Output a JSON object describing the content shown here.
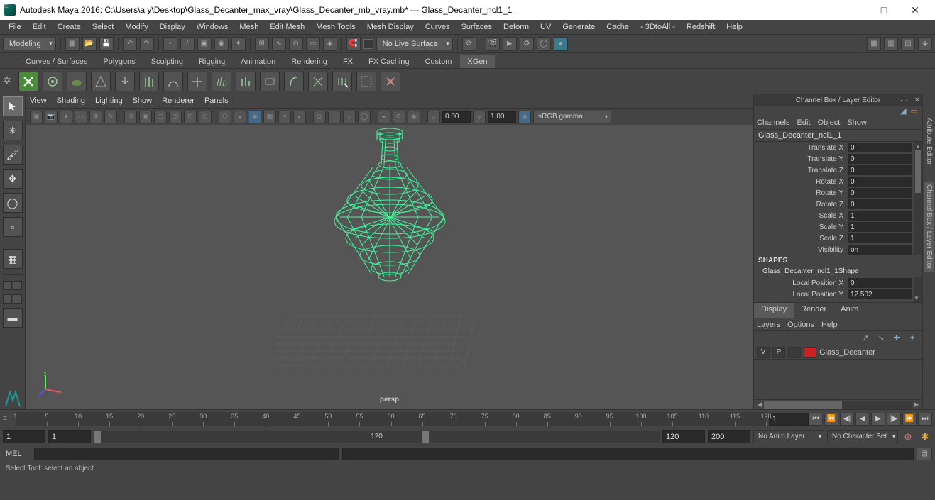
{
  "titlebar": {
    "text": "Autodesk Maya 2016: C:\\Users\\a y\\Desktop\\Glass_Decanter_max_vray\\Glass_Decanter_mb_vray.mb*   ---   Glass_Decanter_ncl1_1"
  },
  "menus": [
    "File",
    "Edit",
    "Create",
    "Select",
    "Modify",
    "Display",
    "Windows",
    "Mesh",
    "Edit Mesh",
    "Mesh Tools",
    "Mesh Display",
    "Curves",
    "Surfaces",
    "Deform",
    "UV",
    "Generate",
    "Cache",
    "- 3DtoAll -",
    "Redshift",
    "Help"
  ],
  "workspace_mode": "Modeling",
  "no_live_surface": "No Live Surface",
  "shelf_tabs": [
    "Curves / Surfaces",
    "Polygons",
    "Sculpting",
    "Rigging",
    "Animation",
    "Rendering",
    "FX",
    "FX Caching",
    "Custom",
    "XGen"
  ],
  "shelf_active": "XGen",
  "viewport": {
    "menus": [
      "View",
      "Shading",
      "Lighting",
      "Show",
      "Renderer",
      "Panels"
    ],
    "field1": "0.00",
    "field2": "1.00",
    "color_mode": "sRGB gamma",
    "label": "persp"
  },
  "channel_box": {
    "title": "Channel Box / Layer Editor",
    "menus": [
      "Channels",
      "Edit",
      "Object",
      "Show"
    ],
    "object": "Glass_Decanter_ncl1_1",
    "attrs": [
      {
        "label": "Translate X",
        "value": "0"
      },
      {
        "label": "Translate Y",
        "value": "0"
      },
      {
        "label": "Translate Z",
        "value": "0"
      },
      {
        "label": "Rotate X",
        "value": "0"
      },
      {
        "label": "Rotate Y",
        "value": "0"
      },
      {
        "label": "Rotate Z",
        "value": "0"
      },
      {
        "label": "Scale X",
        "value": "1"
      },
      {
        "label": "Scale Y",
        "value": "1"
      },
      {
        "label": "Scale Z",
        "value": "1"
      },
      {
        "label": "Visibility",
        "value": "on"
      }
    ],
    "shapes_header": "SHAPES",
    "shape_name": "Glass_Decanter_ncl1_1Shape",
    "shape_attrs": [
      {
        "label": "Local Position X",
        "value": "0"
      },
      {
        "label": "Local Position Y",
        "value": "12.502"
      }
    ],
    "layer_tabs": [
      "Display",
      "Render",
      "Anim"
    ],
    "layer_active": "Display",
    "layer_menus": [
      "Layers",
      "Options",
      "Help"
    ],
    "layer": {
      "v": "V",
      "p": "P",
      "name": "Glass_Decanter"
    }
  },
  "vtabs": [
    "Attribute Editor",
    "Channel Box / Layer Editor"
  ],
  "timeline": {
    "ticks": [
      1,
      5,
      10,
      15,
      20,
      25,
      30,
      35,
      40,
      45,
      50,
      55,
      60,
      65,
      70,
      75,
      80,
      85,
      90,
      95,
      100,
      105,
      110,
      115,
      120
    ],
    "current": "1"
  },
  "range": {
    "start": "1",
    "in": "1",
    "mid": "120",
    "out": "120",
    "end": "200",
    "anim_layer": "No Anim Layer",
    "char_set": "No Character Set"
  },
  "cmd": {
    "label": "MEL"
  },
  "status": "Select Tool: select an object"
}
